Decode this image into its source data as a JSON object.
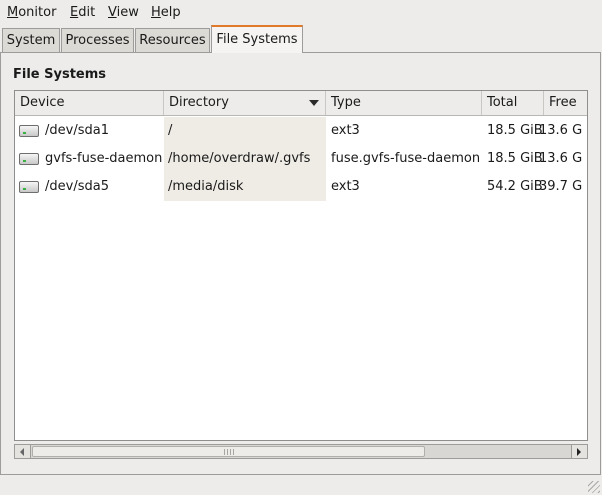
{
  "menubar": {
    "items": [
      {
        "underline": "M",
        "rest": "onitor"
      },
      {
        "underline": "E",
        "rest": "dit"
      },
      {
        "underline": "V",
        "rest": "iew"
      },
      {
        "underline": "H",
        "rest": "elp"
      }
    ]
  },
  "tabs": [
    {
      "label": "System"
    },
    {
      "label": "Processes"
    },
    {
      "label": "Resources"
    },
    {
      "label": "File Systems",
      "active": true
    }
  ],
  "section_title": "File Systems",
  "table": {
    "columns": [
      "Device",
      "Directory",
      "Type",
      "Total",
      "Free"
    ],
    "sorted_column": "Directory",
    "rows": [
      {
        "device": "/dev/sda1",
        "directory": "/",
        "type": "ext3",
        "total": "18.5 GiB",
        "free": "13.6 G"
      },
      {
        "device": "gvfs-fuse-daemon",
        "directory": "/home/overdraw/.gvfs",
        "type": "fuse.gvfs-fuse-daemon",
        "total": "18.5 GiB",
        "free": "13.6 G"
      },
      {
        "device": "/dev/sda5",
        "directory": "/media/disk",
        "type": "ext3",
        "total": "54.2 GiB",
        "free": "39.7 G"
      }
    ]
  },
  "colors": {
    "active_tab_accent": "#e07a2a",
    "window_bg": "#edeceb"
  }
}
